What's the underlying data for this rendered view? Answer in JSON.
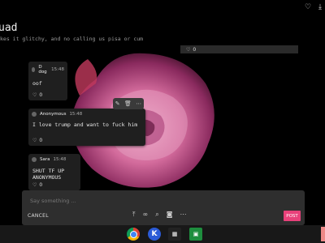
{
  "header": {
    "title": "uad",
    "subtitle": "kes it glitchy, and no calling us pisa or cum"
  },
  "pinned": {
    "likes": "0"
  },
  "messages": [
    {
      "author": "D dog",
      "time": "15:48",
      "text": "oof",
      "likes": "0"
    },
    {
      "author": "Anonymous",
      "time": "15:48",
      "text": "I love trump and want to fuck him",
      "likes": "0"
    },
    {
      "author": "Sara",
      "time": "15:48",
      "text": "SHUT TF UP ANONYMOUS",
      "likes": "0"
    }
  ],
  "composer": {
    "placeholder": "Say something ...",
    "cancel_label": "CANCEL",
    "post_label": "POST"
  },
  "icons": {
    "top": [
      "heart-icon",
      "download-icon"
    ],
    "message_toolbar": [
      "edit-icon",
      "delete-icon",
      "more-icon"
    ],
    "composer_tools": [
      "upload-icon",
      "link-icon",
      "search-icon",
      "camera-icon",
      "more-icon"
    ],
    "shelf": [
      "chrome-app-icon",
      "k-app-icon",
      "app-icon",
      "classroom-app-icon"
    ]
  },
  "colors": {
    "accent": "#e8417a",
    "card": "#1f1f1f",
    "background": "#000000"
  }
}
